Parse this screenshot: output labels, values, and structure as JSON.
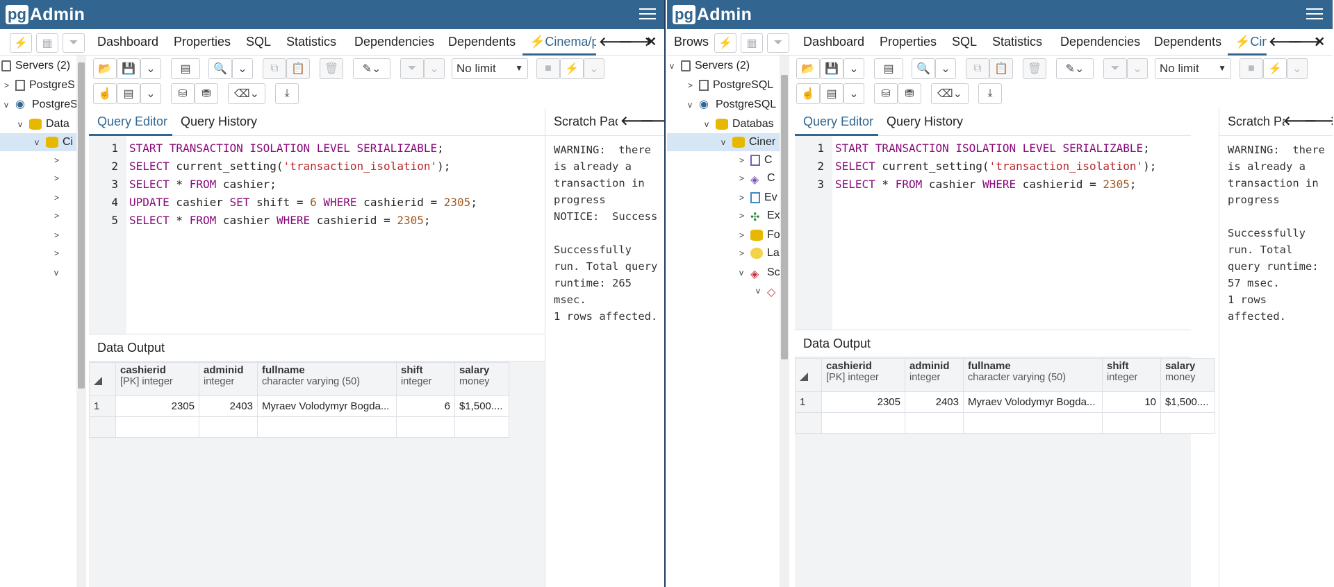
{
  "app": {
    "logo_pg": "pg",
    "logo_admin": "Admin"
  },
  "colors": {
    "brand": "#326690",
    "keyword": "#8a0a7a",
    "string": "#b8282b",
    "number": "#a0581e"
  },
  "left": {
    "tabs": [
      "Dashboard",
      "Properties",
      "SQL",
      "Statistics",
      "Dependencies",
      "Dependents",
      "Cinema/pc"
    ],
    "tree": {
      "servers": "Servers (2)",
      "pg1": "PostgreS",
      "pg2": "PostgreS",
      "db": "Data",
      "cinema": "Ci"
    },
    "limit": "No limit",
    "query_tabs": {
      "editor": "Query Editor",
      "history": "Query History"
    },
    "lines": [
      {
        "n": "1",
        "parts": [
          [
            "kw",
            "START TRANSACTION ISOLATION LEVEL SERIALIZABLE"
          ],
          [
            "",
            "; "
          ]
        ]
      },
      {
        "n": "2",
        "parts": [
          [
            "kw",
            "SELECT"
          ],
          [
            "",
            " current_setting("
          ],
          [
            "str",
            "'transaction_isolation'"
          ],
          [
            "",
            ");"
          ]
        ]
      },
      {
        "n": "3",
        "parts": [
          [
            "kw",
            "SELECT"
          ],
          [
            "",
            " * "
          ],
          [
            "kw",
            "FROM"
          ],
          [
            "",
            " cashier;"
          ]
        ]
      },
      {
        "n": "4",
        "parts": [
          [
            "kw",
            "UPDATE"
          ],
          [
            "",
            " cashier "
          ],
          [
            "kw",
            "SET"
          ],
          [
            "",
            " shift = "
          ],
          [
            "num",
            "6"
          ],
          [
            "kw",
            " WHERE"
          ],
          [
            "",
            " cashierid = "
          ],
          [
            "num",
            "2305"
          ],
          [
            "",
            ";"
          ]
        ]
      },
      {
        "n": "5",
        "parts": [
          [
            "kw",
            "SELECT"
          ],
          [
            "",
            " * "
          ],
          [
            "kw",
            "FROM"
          ],
          [
            "",
            " cashier "
          ],
          [
            "kw",
            "WHERE"
          ],
          [
            "",
            " cashierid = "
          ],
          [
            "num",
            "2305"
          ],
          [
            "",
            ";"
          ]
        ]
      }
    ],
    "scratch_title": "Scratch Pac",
    "scratch_text": "WARNING:  there\nis already a\ntransaction in\nprogress\nNOTICE:  Success\n\nSuccessfully\nrun. Total query\nruntime: 265\nmsec.\n1 rows affected.",
    "output_title": "Data Output",
    "columns": [
      {
        "name": "cashierid",
        "type": "[PK] integer"
      },
      {
        "name": "adminid",
        "type": "integer"
      },
      {
        "name": "fullname",
        "type": "character varying (50)"
      },
      {
        "name": "shift",
        "type": "integer"
      },
      {
        "name": "salary",
        "type": "money"
      }
    ],
    "rows": [
      {
        "n": "1",
        "cashierid": "2305",
        "adminid": "2403",
        "fullname": "Myraev Volodymyr Bogda...",
        "shift": "6",
        "salary": "$1,500...."
      }
    ]
  },
  "right": {
    "browser_label": "Brows",
    "tabs": [
      "Dashboard",
      "Properties",
      "SQL",
      "Statistics",
      "Dependencies",
      "Dependents",
      "Cin"
    ],
    "tree": {
      "servers": "Servers (2)",
      "pg1": "PostgreSQL",
      "pg2": "PostgreSQL",
      "db": "Databas",
      "cinema": "Ciner",
      "c1": "C",
      "c2": "C",
      "ev": "Ev",
      "ex": "Ex",
      "fo": "Fo",
      "la": "La",
      "sc": "Sc"
    },
    "limit": "No limit",
    "query_tabs": {
      "editor": "Query Editor",
      "history": "Query History"
    },
    "lines": [
      {
        "n": "1",
        "parts": [
          [
            "kw",
            "START TRANSACTION ISOLATION LEVEL SERIALIZABLE"
          ],
          [
            "",
            ";"
          ]
        ]
      },
      {
        "n": "2",
        "parts": [
          [
            "kw",
            "SELECT"
          ],
          [
            "",
            " current_setting("
          ],
          [
            "str",
            "'transaction_isolation'"
          ],
          [
            "",
            ");"
          ]
        ]
      },
      {
        "n": "3",
        "parts": [
          [
            "kw",
            "SELECT"
          ],
          [
            "",
            " * "
          ],
          [
            "kw",
            "FROM"
          ],
          [
            "",
            " cashier "
          ],
          [
            "kw",
            "WHERE"
          ],
          [
            "",
            " cashierid = "
          ],
          [
            "num",
            "2305"
          ],
          [
            "",
            ";"
          ]
        ]
      }
    ],
    "scratch_title": "Scratch Pa",
    "scratch_text": "WARNING:  there\nis already a\ntransaction in\nprogress\n\nSuccessfully\nrun. Total\nquery runtime:\n57 msec.\n1 rows\naffected.",
    "output_title": "Data Output",
    "columns": [
      {
        "name": "cashierid",
        "type": "[PK] integer"
      },
      {
        "name": "adminid",
        "type": "integer"
      },
      {
        "name": "fullname",
        "type": "character varying (50)"
      },
      {
        "name": "shift",
        "type": "integer"
      },
      {
        "name": "salary",
        "type": "money"
      }
    ],
    "rows": [
      {
        "n": "1",
        "cashierid": "2305",
        "adminid": "2403",
        "fullname": "Myraev Volodymyr Bogda...",
        "shift": "10",
        "salary": "$1,500...."
      }
    ]
  }
}
